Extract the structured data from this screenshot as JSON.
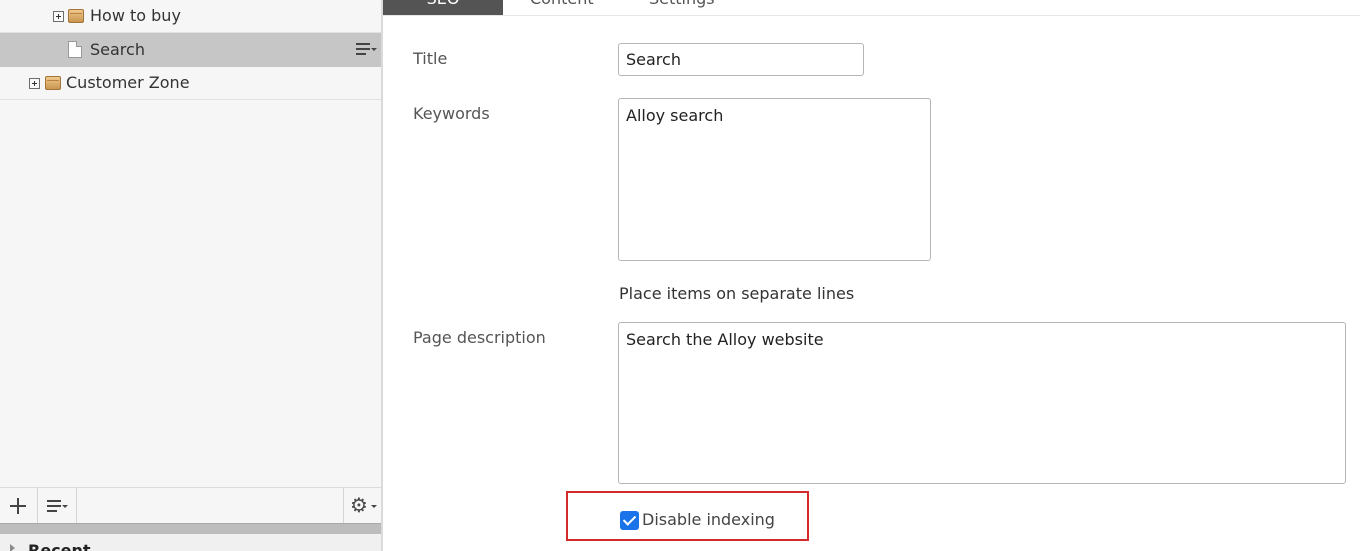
{
  "tree": {
    "items": [
      {
        "label": "How to buy",
        "icon": "folder-icon",
        "expandable": true
      },
      {
        "label": "Search",
        "icon": "page-icon",
        "selected": true
      },
      {
        "label": "Customer Zone",
        "icon": "folder-icon",
        "expandable": true
      }
    ]
  },
  "left_toolbar": {
    "add_icon": "plus-icon",
    "list_icon": "list-menu-icon",
    "settings_icon": "gear-icon"
  },
  "recent": {
    "label": "Recent"
  },
  "tabs": [
    {
      "label": "SEO",
      "active": true
    },
    {
      "label": "Content"
    },
    {
      "label": "Settings"
    }
  ],
  "form": {
    "title": {
      "label": "Title",
      "value": "Search"
    },
    "keywords": {
      "label": "Keywords",
      "value": "Alloy search",
      "help": "Place items on separate lines"
    },
    "page_description": {
      "label": "Page description",
      "value": "Search the Alloy website"
    },
    "disable_indexing": {
      "label": "Disable indexing",
      "checked": true
    }
  },
  "colors": {
    "selected_row": "#c6c6c6",
    "active_tab": "#545454",
    "checkbox": "#1a73e8",
    "highlight": "#d42a2a"
  }
}
